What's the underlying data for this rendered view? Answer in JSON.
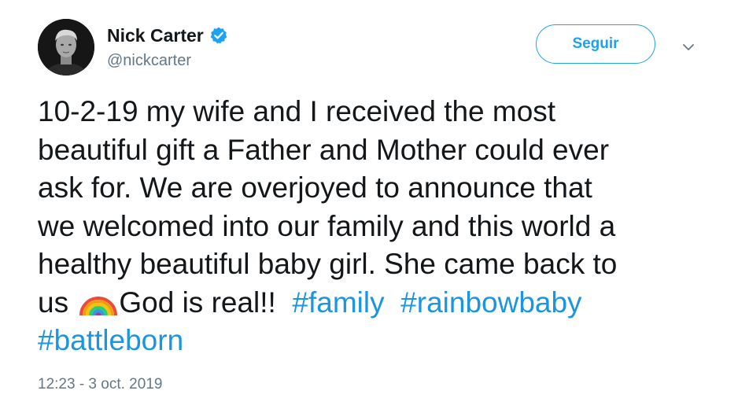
{
  "author": {
    "display_name": "Nick Carter",
    "handle": "@nickcarter",
    "verified": true
  },
  "actions": {
    "follow_label": "Seguir",
    "more_icon": "chevron-down-icon"
  },
  "tweet": {
    "line1": "10-2-19 my wife and I received the most",
    "line2": "beautiful gift a Father and Mother could ever",
    "line3": "ask for. We are overjoyed to announce that",
    "line4": "we welcomed into our family and this world a",
    "line5": "healthy beautiful baby girl. She came back to",
    "line6_start": "us ",
    "emoji": "rainbow-icon",
    "line6_after_emoji": "God is real!!",
    "hashtags": [
      "#family",
      "#rainbowbaby",
      "#battleborn"
    ]
  },
  "timestamp": "12:23 - 3 oct. 2019",
  "colors": {
    "accent": "#1da1f2",
    "hashtag": "#1b95e0",
    "secondary_text": "#657786",
    "primary_text": "#14171a"
  }
}
